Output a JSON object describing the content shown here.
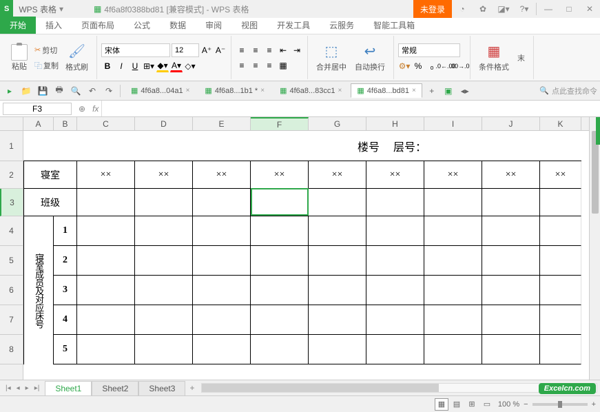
{
  "titlebar": {
    "logo": "S",
    "app_name": "WPS 表格",
    "doc_title": "4f6a8f0388bd81 [兼容模式] - WPS 表格",
    "login_btn": "未登录"
  },
  "menutabs": [
    "开始",
    "插入",
    "页面布局",
    "公式",
    "数据",
    "审阅",
    "视图",
    "开发工具",
    "云服务",
    "智能工具箱"
  ],
  "ribbon": {
    "paste": "粘贴",
    "cut": "剪切",
    "copy": "复制",
    "format_painter": "格式刷",
    "font_name": "宋体",
    "font_size": "12",
    "merge_center": "合并居中",
    "auto_wrap": "自动换行",
    "number_format": "常规",
    "cond_format": "条件格式",
    "template": "末"
  },
  "doc_tabs": [
    {
      "label": "4f6a8...04a1",
      "suffix": "×",
      "active": false
    },
    {
      "label": "4f6a8...1b1 *",
      "suffix": "×",
      "active": false
    },
    {
      "label": "4f6a8...83cc1",
      "suffix": "×",
      "active": false
    },
    {
      "label": "4f6a8...bd81",
      "suffix": "×",
      "active": true
    }
  ],
  "qa_search_placeholder": "点此查找命令",
  "formulabar": {
    "cellname": "F3",
    "fx": "fx"
  },
  "columns": [
    "A",
    "B",
    "C",
    "D",
    "E",
    "F",
    "G",
    "H",
    "I",
    "J",
    "K"
  ],
  "rows": [
    "1",
    "2",
    "3",
    "4",
    "5",
    "6",
    "7",
    "8"
  ],
  "sheet": {
    "row1_building": "楼号",
    "row1_floor": "层号：",
    "row2_label": "寝室",
    "row2_vals": [
      "××",
      "××",
      "××",
      "××",
      "××",
      "××",
      "××",
      "××",
      "××"
    ],
    "row3_label": "班级",
    "vertical_label_c1": "寝室成员及对应床号",
    "vertical_label_c2": "",
    "bed_numbers": [
      "1",
      "2",
      "3",
      "4",
      "5"
    ]
  },
  "sheet_tabs": [
    "Sheet1",
    "Sheet2",
    "Sheet3"
  ],
  "statusbar": {
    "zoom": "100 %"
  },
  "watermark": "Excelcn.com"
}
